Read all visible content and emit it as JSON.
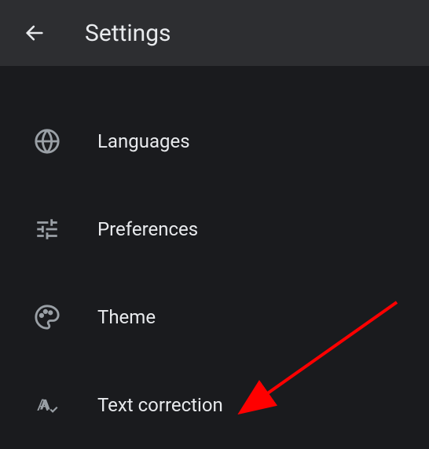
{
  "header": {
    "title": "Settings"
  },
  "items": [
    {
      "label": "Languages"
    },
    {
      "label": "Preferences"
    },
    {
      "label": "Theme"
    },
    {
      "label": "Text correction"
    }
  ]
}
